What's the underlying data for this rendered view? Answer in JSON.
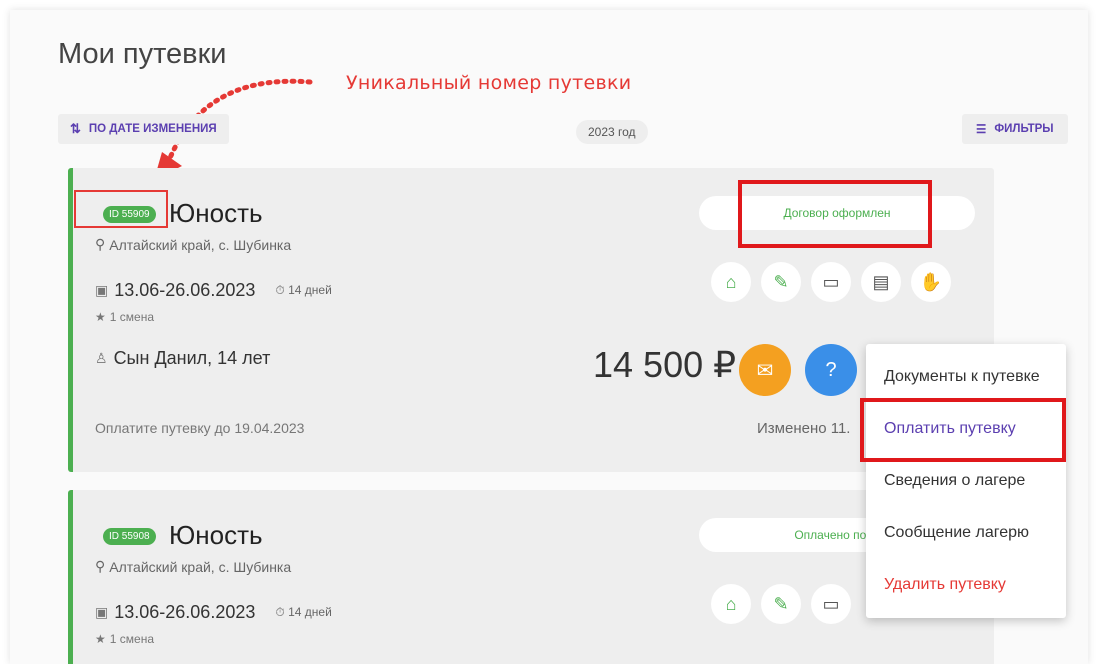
{
  "page": {
    "title": "Мои путевки"
  },
  "annotation": {
    "label": "Уникальный номер путевки"
  },
  "toolbar": {
    "sort_label": "ПО ДАТЕ ИЗМЕНЕНИЯ",
    "sort_icon": "sort-icon",
    "year": "2023 год",
    "filter_label": "ФИЛЬТРЫ",
    "filter_icon": "filter-icon"
  },
  "vouchers": [
    {
      "id": "ID 55909",
      "name": "Юность",
      "location": "Алтайский край, с. Шубинка",
      "dates": "13.06-26.06.2023",
      "duration": "14 дней",
      "shift": "1 смена",
      "child": "Сын Данил, 14 лет",
      "price": "14 500 ₽",
      "pay_until": "Оплатите путевку до 19.04.2023",
      "changed": "Изменено 11.",
      "status": "Договор оформлен"
    },
    {
      "id": "ID 55908",
      "name": "Юность",
      "location": "Алтайский край, с. Шубинка",
      "dates": "13.06-26.06.2023",
      "duration": "14 дней",
      "shift": "1 смена",
      "status": "Оплачено полн"
    }
  ],
  "context_menu": {
    "items": [
      {
        "label": "Документы к путевке"
      },
      {
        "label": "Оплатить путевку"
      },
      {
        "label": "Сведения о лагере"
      },
      {
        "label": "Сообщение лагерю"
      },
      {
        "label": "Удалить путевку"
      }
    ]
  },
  "colors": {
    "accent": "#5b3fb0",
    "success": "#4caf50",
    "highlight": "#e0181b",
    "message_button": "#f4a020",
    "help_button": "#3a8fe8"
  }
}
